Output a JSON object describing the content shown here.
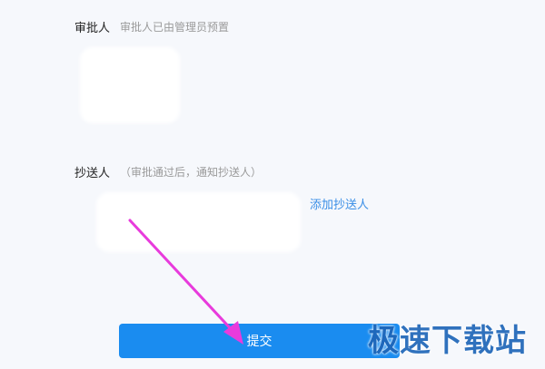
{
  "approver": {
    "label": "审批人",
    "hint": "审批人已由管理员预置"
  },
  "cc": {
    "label": "抄送人",
    "hint": "（审批通过后，通知抄送人）",
    "add_link": "添加抄送人"
  },
  "submit_label": "提交",
  "watermark": "极速下载站",
  "colors": {
    "accent": "#1a8cf0",
    "link": "#3a8ee6",
    "annotation_arrow": "#e83bdc"
  }
}
